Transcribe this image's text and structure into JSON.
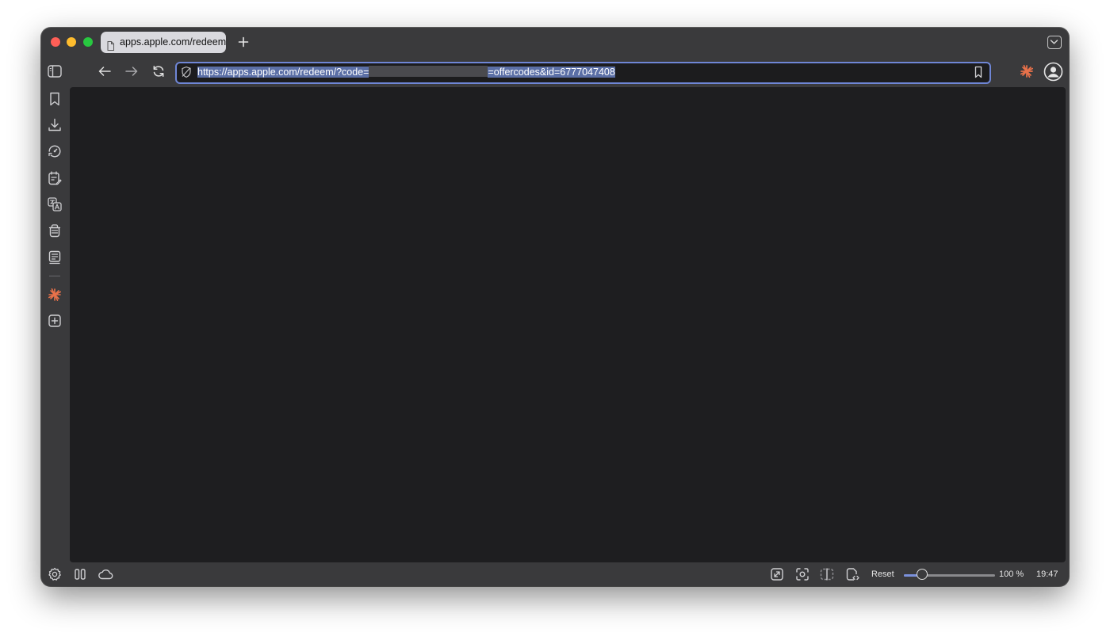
{
  "tab": {
    "title": "apps.apple.com/redeem/?c",
    "page_icon": "document-icon"
  },
  "toolbar": {
    "url_prefix": "https://apps.apple.com/redeem/?code=",
    "url_suffix": "=offercodes&id=6777047408"
  },
  "sidebar": {
    "items": [
      {
        "icon": "sidebar-toggle-icon"
      },
      {
        "icon": "bookmark-icon"
      },
      {
        "icon": "download-icon"
      },
      {
        "icon": "history-icon"
      },
      {
        "icon": "notes-icon"
      },
      {
        "icon": "translate-icon"
      },
      {
        "icon": "reading-list-icon"
      },
      {
        "icon": "reader-icon"
      },
      {
        "icon": "ai-assistant-icon"
      },
      {
        "icon": "add-panel-icon"
      }
    ]
  },
  "statusbar": {
    "reset_label": "Reset",
    "zoom_label": "100 %",
    "zoom_fraction": 0.2,
    "clock": "19:47"
  },
  "colors": {
    "accent": "#7b91dc",
    "ai_icon": "#e8714a",
    "close": "#ff5f57",
    "minimize": "#febc2e",
    "maximize": "#28c840"
  }
}
